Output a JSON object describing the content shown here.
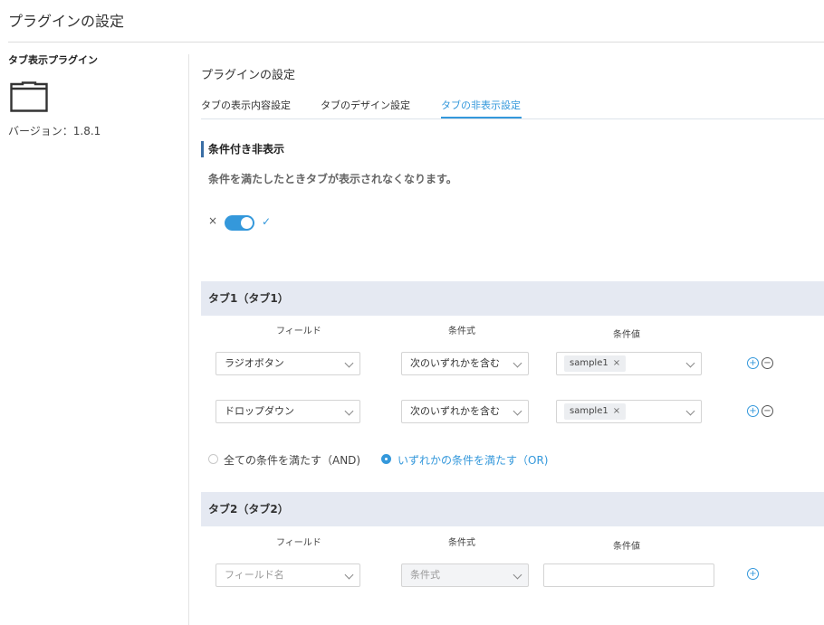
{
  "page": {
    "title": "プラグインの設定"
  },
  "sidebar": {
    "plugin_name": "タブ表示プラグイン",
    "icon": "folder-icon",
    "version": "バージョン：1.8.1"
  },
  "main": {
    "settings_title": "プラグインの設定",
    "tabs": [
      {
        "label": "タブの表示内容設定",
        "active": false
      },
      {
        "label": "タブのデザイン設定",
        "active": false
      },
      {
        "label": "タブの非表示設定",
        "active": true
      }
    ],
    "section": {
      "heading": "条件付き非表示",
      "description": "条件を満たしたときタブが表示されなくなります。",
      "toggle": {
        "off_label": "×",
        "on_label": "✓",
        "enabled": true
      }
    },
    "columns": {
      "field": "フィールド",
      "condition": "条件式",
      "value": "条件値"
    },
    "blocks": [
      {
        "header": "タブ1（タブ1）",
        "rows": [
          {
            "field": "ラジオボタン",
            "condition": "次のいずれかを含む",
            "tag": "sample1"
          },
          {
            "field": "ドロップダウン",
            "condition": "次のいずれかを含む",
            "tag": "sample1"
          }
        ],
        "match_options": [
          {
            "label": "全ての条件を満たす（AND)",
            "checked": false
          },
          {
            "label": "いずれかの条件を満たす（OR)",
            "checked": true
          }
        ]
      },
      {
        "header": "タブ2（タブ2）",
        "rows": [
          {
            "field_placeholder": "フィールド名",
            "condition_placeholder": "条件式",
            "value": ""
          }
        ]
      }
    ]
  },
  "colors": {
    "accent": "#3498db",
    "header_bg": "#e5e9f2",
    "section_bar": "#3a6ea5"
  }
}
